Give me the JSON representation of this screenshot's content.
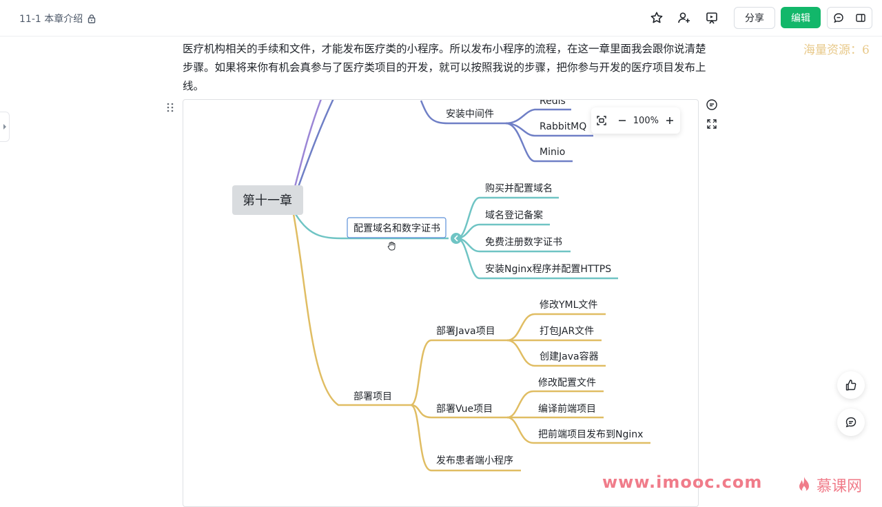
{
  "header": {
    "doc_title": "11-1 本章介绍",
    "share_label": "分享",
    "edit_label": "编辑",
    "icons": [
      "star-icon",
      "add-collaborator-icon",
      "present-icon",
      "comment-icon",
      "sidebar-layout-icon",
      "lock-icon"
    ]
  },
  "content": {
    "paragraph": "医疗机构相关的手续和文件，才能发布医疗类的小程序。所以发布小程序的流程，在这一章里面我会跟你说清楚步骤。如果将来你有机会真参与了医疗类项目的开发，就可以按照我说的步骤，把你参与开发的医疗项目发布上线。",
    "watermark": "海量资源：6"
  },
  "mindmap": {
    "zoom": "100%",
    "root": "第十一章",
    "branch_middleware": {
      "label": "安装中间件",
      "children": [
        "Redis",
        "RabbitMQ",
        "Minio"
      ]
    },
    "branch_domain": {
      "label": "配置域名和数字证书",
      "children": [
        "购买并配置域名",
        "域名登记备案",
        "免费注册数字证书",
        "安装Nginx程序并配置HTTPS"
      ]
    },
    "branch_deploy": {
      "label": "部署项目",
      "java": {
        "label": "部署Java项目",
        "children": [
          "修改YML文件",
          "打包JAR文件",
          "创建Java容器"
        ]
      },
      "vue": {
        "label": "部署Vue项目",
        "children": [
          "修改配置文件",
          "编译前端项目",
          "把前端项目发布到Nginx"
        ]
      },
      "mini": {
        "label": "发布患者端小程序"
      }
    },
    "colors": {
      "purple": "#9b86d6",
      "blue": "#6f7fc6",
      "teal": "#6fc4c4",
      "gold": "#e0bd63",
      "root_bg": "#d9dcdf"
    }
  },
  "footer": {
    "site": "www.imooc.com",
    "brand": "慕课网"
  }
}
